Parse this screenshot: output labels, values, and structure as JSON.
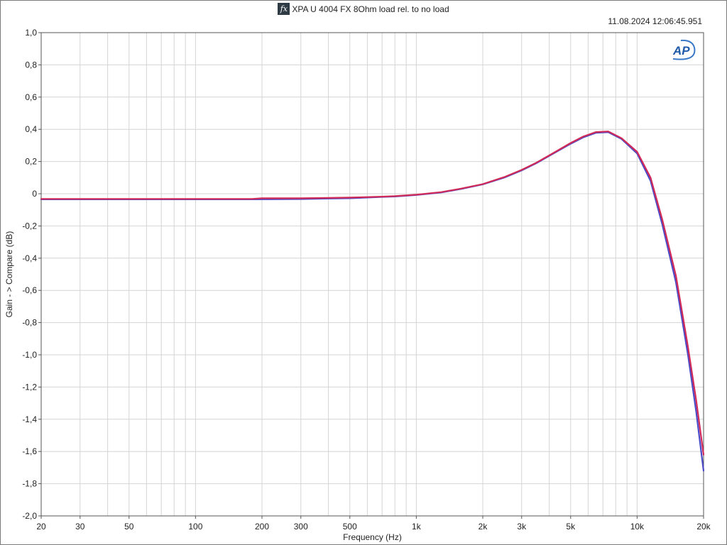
{
  "header": {
    "icon": "fx-icon",
    "timestamp": "11.08.2024 12:06:45.951",
    "logo_text": "AP"
  },
  "chart_data": {
    "type": "line",
    "title": "XPA U 4004 FX 8Ohm load rel. to no load",
    "xlabel": "Frequency (Hz)",
    "ylabel": "Gain - > Compare (dB)",
    "x_scale": "log",
    "xlim": [
      20,
      20000
    ],
    "ylim": [
      -2.0,
      1.0
    ],
    "grid": true,
    "legend": "none",
    "x_ticks": [
      {
        "value": 20,
        "label": "20"
      },
      {
        "value": 30,
        "label": "30"
      },
      {
        "value": 50,
        "label": "50"
      },
      {
        "value": 100,
        "label": "100"
      },
      {
        "value": 200,
        "label": "200"
      },
      {
        "value": 300,
        "label": "300"
      },
      {
        "value": 500,
        "label": "500"
      },
      {
        "value": 1000,
        "label": "1k"
      },
      {
        "value": 2000,
        "label": "2k"
      },
      {
        "value": 3000,
        "label": "3k"
      },
      {
        "value": 5000,
        "label": "5k"
      },
      {
        "value": 10000,
        "label": "10k"
      },
      {
        "value": 20000,
        "label": "20k"
      }
    ],
    "y_ticks": [
      {
        "value": 1.0,
        "label": "1,0"
      },
      {
        "value": 0.8,
        "label": "0,8"
      },
      {
        "value": 0.6,
        "label": "0,6"
      },
      {
        "value": 0.4,
        "label": "0,4"
      },
      {
        "value": 0.2,
        "label": "0,2"
      },
      {
        "value": 0.0,
        "label": "0"
      },
      {
        "value": -0.2,
        "label": "-0,2"
      },
      {
        "value": -0.4,
        "label": "-0,4"
      },
      {
        "value": -0.6,
        "label": "-0,6"
      },
      {
        "value": -0.8,
        "label": "-0,8"
      },
      {
        "value": -1.0,
        "label": "-1,0"
      },
      {
        "value": -1.2,
        "label": "-1,2"
      },
      {
        "value": -1.4,
        "label": "-1,4"
      },
      {
        "value": -1.6,
        "label": "-1,6"
      },
      {
        "value": -1.8,
        "label": "-1,8"
      },
      {
        "value": -2.0,
        "label": "-2,0"
      }
    ],
    "series": [
      {
        "color": "#4a4ac8",
        "points": [
          [
            20,
            -0.035
          ],
          [
            50,
            -0.035
          ],
          [
            100,
            -0.035
          ],
          [
            180,
            -0.035
          ],
          [
            300,
            -0.033
          ],
          [
            400,
            -0.03
          ],
          [
            500,
            -0.028
          ],
          [
            700,
            -0.02
          ],
          [
            800,
            -0.017
          ],
          [
            1000,
            -0.008
          ],
          [
            1300,
            0.008
          ],
          [
            1600,
            0.03
          ],
          [
            2000,
            0.058
          ],
          [
            2500,
            0.1
          ],
          [
            3000,
            0.145
          ],
          [
            3500,
            0.19
          ],
          [
            4000,
            0.235
          ],
          [
            5000,
            0.31
          ],
          [
            5700,
            0.35
          ],
          [
            6500,
            0.378
          ],
          [
            7400,
            0.382
          ],
          [
            8500,
            0.34
          ],
          [
            10000,
            0.25
          ],
          [
            11500,
            0.08
          ],
          [
            13000,
            -0.19
          ],
          [
            15000,
            -0.55
          ],
          [
            17000,
            -1.0
          ],
          [
            18500,
            -1.35
          ],
          [
            20000,
            -1.72
          ]
        ]
      },
      {
        "color": "#d02a58",
        "points": [
          [
            20,
            -0.032
          ],
          [
            50,
            -0.032
          ],
          [
            100,
            -0.032
          ],
          [
            180,
            -0.032
          ],
          [
            200,
            -0.028
          ],
          [
            300,
            -0.028
          ],
          [
            400,
            -0.026
          ],
          [
            500,
            -0.024
          ],
          [
            700,
            -0.018
          ],
          [
            800,
            -0.015
          ],
          [
            1000,
            -0.006
          ],
          [
            1300,
            0.01
          ],
          [
            1600,
            0.032
          ],
          [
            2000,
            0.06
          ],
          [
            2500,
            0.103
          ],
          [
            3000,
            0.148
          ],
          [
            3500,
            0.193
          ],
          [
            4000,
            0.238
          ],
          [
            5000,
            0.315
          ],
          [
            5700,
            0.355
          ],
          [
            6500,
            0.383
          ],
          [
            7400,
            0.387
          ],
          [
            8500,
            0.345
          ],
          [
            10000,
            0.26
          ],
          [
            11500,
            0.1
          ],
          [
            13000,
            -0.16
          ],
          [
            15000,
            -0.51
          ],
          [
            17000,
            -0.95
          ],
          [
            18500,
            -1.28
          ],
          [
            20000,
            -1.62
          ]
        ]
      }
    ]
  }
}
